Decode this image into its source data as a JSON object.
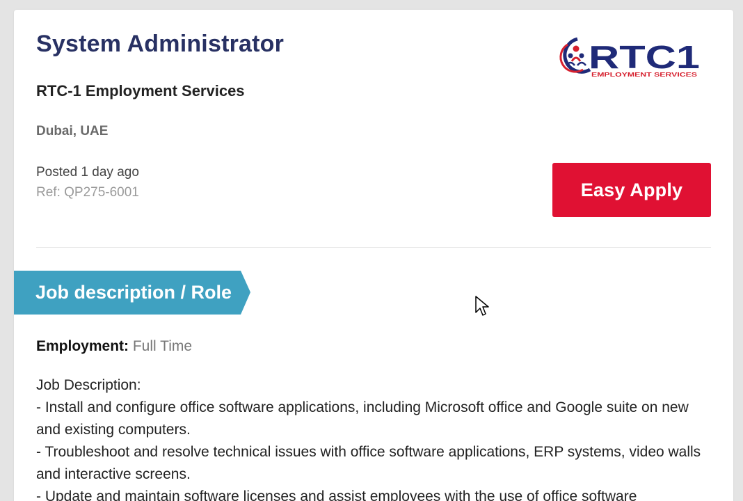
{
  "job": {
    "title": "System Administrator",
    "company": "RTC-1 Employment Services",
    "location": "Dubai, UAE",
    "posted": "Posted 1 day ago",
    "ref": "Ref: QP275-6001"
  },
  "logo": {
    "text": "RTC1",
    "subtext": "EMPLOYMENT SERVICES"
  },
  "actions": {
    "apply_label": "Easy Apply"
  },
  "section": {
    "title": "Job description / Role"
  },
  "details": {
    "employment_label": "Employment:",
    "employment_value": "Full Time"
  },
  "description": {
    "heading": "Job Description:",
    "lines": [
      "- Install and configure office software applications, including Microsoft office and Google suite on new and existing computers.",
      "- Troubleshoot and resolve technical issues with office software applications, ERP systems, video walls and interactive screens.",
      "- Update and maintain software licenses and assist employees with the use of office software"
    ]
  },
  "colors": {
    "title": "#283163",
    "apply": "#e01133",
    "banner": "#3fa1c1",
    "logo_navy": "#1f2a78",
    "logo_red": "#d6202e"
  },
  "icons": {
    "cursor": "mouse-pointer-icon",
    "logo_mark": "people-circle-icon"
  }
}
